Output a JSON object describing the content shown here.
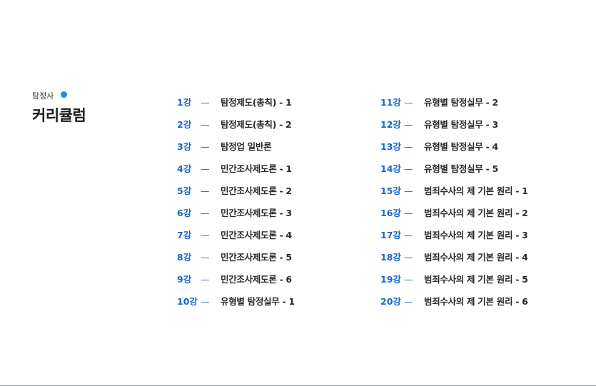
{
  "header": {
    "subtitle": "탐정사",
    "title": "커리큘럼",
    "accent_color": "#1f8be8"
  },
  "curriculum": {
    "separator": "—",
    "left": [
      {
        "num": "1강",
        "name": "탐정제도(총칙) - 1"
      },
      {
        "num": "2강",
        "name": "탐정제도(총칙) - 2"
      },
      {
        "num": "3강",
        "name": "탐정업 일반론"
      },
      {
        "num": "4강",
        "name": "민간조사제도론 - 1"
      },
      {
        "num": "5강",
        "name": "민간조사제도론 - 2"
      },
      {
        "num": "6강",
        "name": "민간조사제도론 - 3"
      },
      {
        "num": "7강",
        "name": "민간조사제도론 - 4"
      },
      {
        "num": "8강",
        "name": "민간조사제도론 - 5"
      },
      {
        "num": "9강",
        "name": "민간조사제도론 - 6"
      },
      {
        "num": "10강",
        "name": "유형별 탐정실무 - 1"
      }
    ],
    "right": [
      {
        "num": "11강",
        "name": "유형별 탐정실무 - 2"
      },
      {
        "num": "12강",
        "name": "유형별 탐정실무 - 3"
      },
      {
        "num": "13강",
        "name": "유형별 탐정실무 - 4"
      },
      {
        "num": "14강",
        "name": "유형별 탐정실무 - 5"
      },
      {
        "num": "15강",
        "name": "범죄수사의 제 기본 원리 - 1"
      },
      {
        "num": "16강",
        "name": "범죄수사의 제 기본 원리 - 2"
      },
      {
        "num": "17강",
        "name": "범죄수사의 제 기본 원리 - 3"
      },
      {
        "num": "18강",
        "name": "범죄수사의 제 기본 원리 - 4"
      },
      {
        "num": "19강",
        "name": "범죄수사의 제 기본 원리 - 5"
      },
      {
        "num": "20강",
        "name": "범죄수사의 제 기본 원리 - 6"
      }
    ]
  }
}
